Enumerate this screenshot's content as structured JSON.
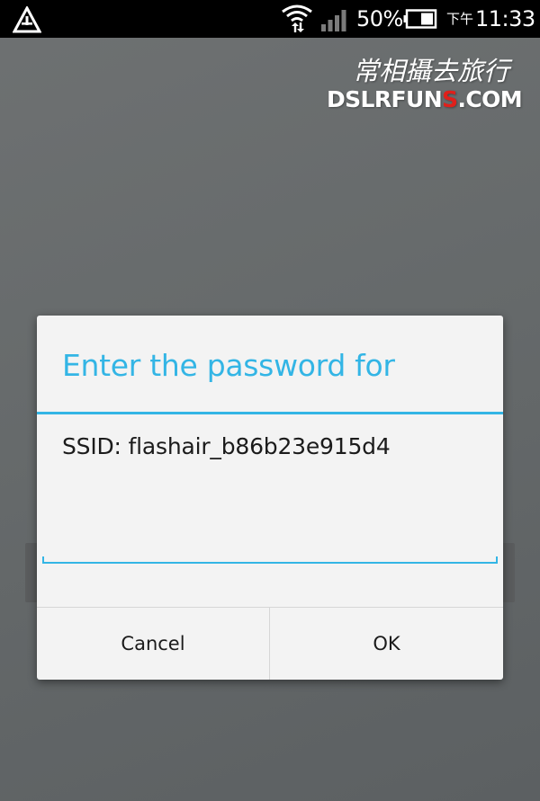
{
  "status_bar": {
    "left_icon": "alert-triangle-icon",
    "wifi_icon": "wifi-data-icon",
    "signal_icon": "cell-signal-icon",
    "battery_percent": "50%",
    "battery_icon": "battery-icon",
    "time_prefix": "下午",
    "time": "11:33"
  },
  "watermark": {
    "line1": "常相攝去旅行",
    "line2_part1": "DSLRFUN",
    "line2_highlight": "S",
    "line2_part2": ".COM",
    "highlight_color": "#e0201b"
  },
  "dialog": {
    "title": "Enter the password for",
    "message": "SSID: flashair_b86b23e915d4",
    "password_value": "",
    "cancel_label": "Cancel",
    "ok_label": "OK",
    "accent_color": "#33b5e5"
  }
}
